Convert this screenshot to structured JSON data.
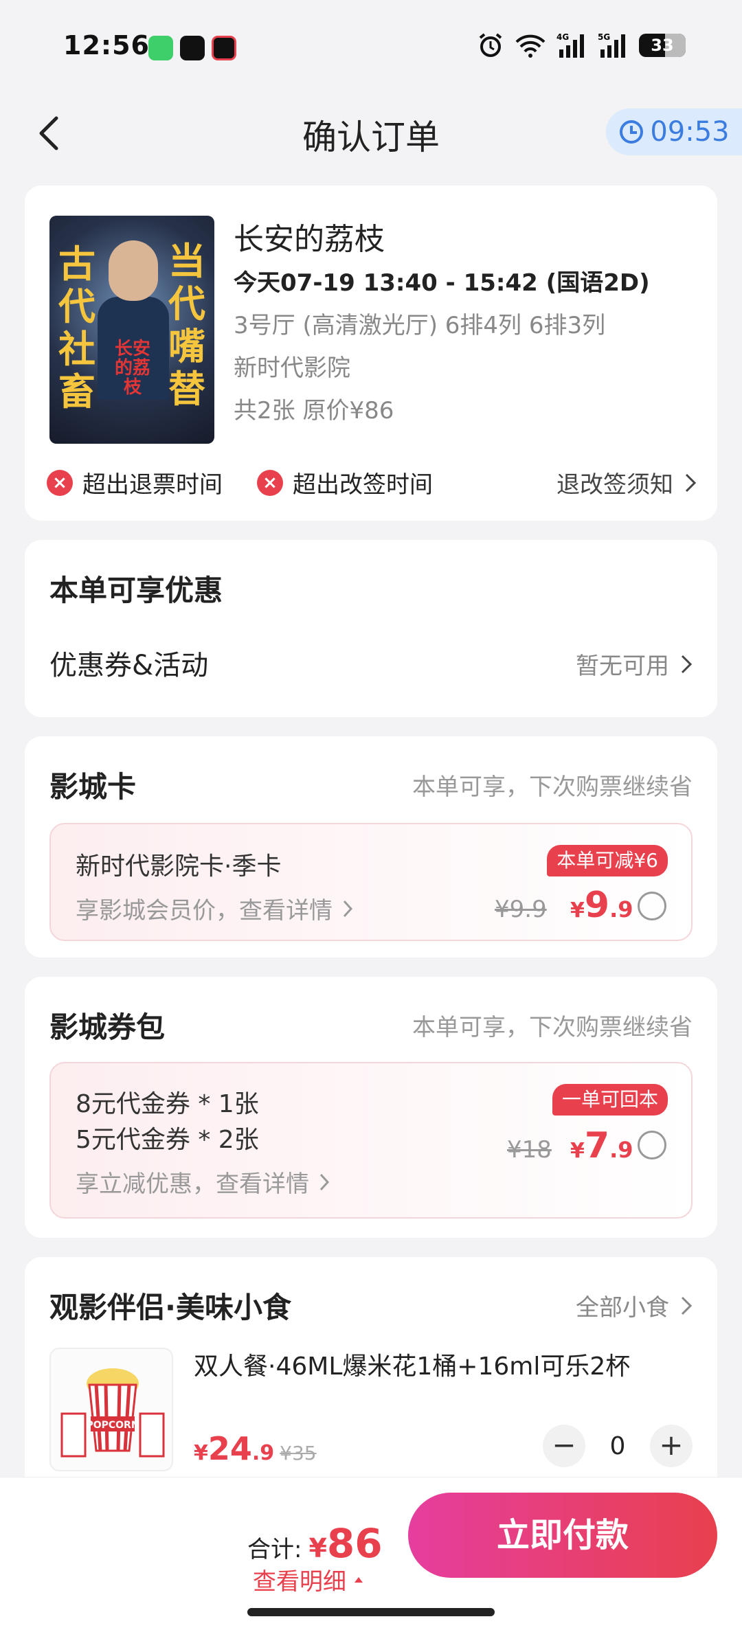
{
  "status_bar": {
    "time": "12:56",
    "apps": [
      "wechat-icon",
      "tiktok-icon",
      "video-icon"
    ],
    "right_icons": [
      "alarm-icon",
      "wifi-icon",
      "signal-4g-icon",
      "signal-5g-icon"
    ],
    "battery": "33"
  },
  "nav": {
    "title": "确认订单",
    "timer": "09:53"
  },
  "movie": {
    "title": "长安的荔枝",
    "showtime": "今天07-19 13:40 - 15:42 (国语2D)",
    "hall": "3号厅 (高清激光厅) 6排4列 6排3列",
    "cinema": "新时代影院",
    "count": "共2张 原价¥86",
    "poster": {
      "left": [
        "古",
        "代",
        "社",
        "畜"
      ],
      "right": [
        "当",
        "代",
        "嘴",
        "替"
      ],
      "logo": "长安的荔枝"
    },
    "rule1": "超出退票时间",
    "rule2": "超出改签时间",
    "rule_link": "退改签须知"
  },
  "discount": {
    "title": "本单可享优惠",
    "row_label": "优惠券&活动",
    "row_value": "暂无可用"
  },
  "cinema_card": {
    "title": "影城卡",
    "subtitle": "本单可享，下次购票继续省",
    "name": "新时代影院卡·季卡",
    "desc": "享影城会员价，查看详情",
    "badge": "本单可减¥6",
    "old_price": "¥9.9",
    "price_cur": "¥",
    "price_int": "9",
    "price_dec": ".9"
  },
  "coupon_pack": {
    "title": "影城券包",
    "subtitle": "本单可享，下次购票继续省",
    "line1": "8元代金券 * 1张",
    "line2": "5元代金券 * 2张",
    "desc": "享立减优惠，查看详情",
    "badge": "一单可回本",
    "old_price": "¥18",
    "price_cur": "¥",
    "price_int": "7",
    "price_dec": ".9"
  },
  "snacks": {
    "title": "观影伴侣·美味小食",
    "all_link": "全部小食",
    "item": {
      "name": "双人餐·46ML爆米花1桶+16ml可乐2杯",
      "price_cur": "¥",
      "price_int": "24",
      "price_dec": ".9",
      "old_price": "¥35",
      "minus": "−",
      "qty": "0",
      "plus": "+",
      "thumb_text": "POPCORN"
    }
  },
  "bottom": {
    "total_label": "合计:",
    "total_cur": "¥",
    "total_amount": "86",
    "detail": "查看明细",
    "pay": "立即付款"
  },
  "colors": {
    "accent": "#e8404d",
    "timer_blue": "#3b7ce0",
    "pay_gradient_start": "#e63e9e"
  }
}
